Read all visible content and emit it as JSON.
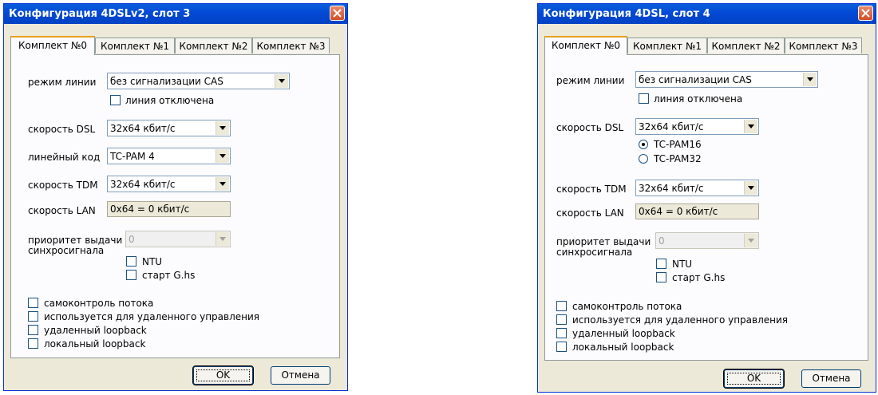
{
  "dialog1": {
    "title": "Конфигурация 4DSLv2, слот 3",
    "tabs": [
      "Комплект №0",
      "Комплект №1",
      "Комплект №2",
      "Комплект №3"
    ],
    "line_mode_label": "режим линии",
    "line_mode_value": "без сигнализации CAS",
    "line_off_label": "линия отключена",
    "dsl_speed_label": "скорость DSL",
    "dsl_speed_value": "32x64 кбит/с",
    "line_code_label": "линейный код",
    "line_code_value": "TC-PAM 4",
    "tdm_speed_label": "скорость TDM",
    "tdm_speed_value": "32x64 кбит/с",
    "lan_speed_label": "скорость LAN",
    "lan_speed_value": "0x64 = 0 кбит/с",
    "sync_priority_label_1": "приоритет выдачи",
    "sync_priority_label_2": "синхросигнала",
    "sync_priority_value": "0",
    "ntu_label": "NTU",
    "start_ghs_label": "старт G.hs",
    "self_check_label": "самоконтроль потока",
    "remote_mgmt_label": "используется для удаленного управления",
    "remote_loopback_label": "удаленный loopback",
    "local_loopback_label": "локальный loopback",
    "ok_label": "OK",
    "cancel_label": "Отмена"
  },
  "dialog2": {
    "title": "Конфигурация 4DSL, слот 4",
    "tabs": [
      "Комплект №0",
      "Комплект №1",
      "Комплект №2",
      "Комплект №3"
    ],
    "line_mode_label": "режим линии",
    "line_mode_value": "без сигнализации CAS",
    "line_off_label": "линия отключена",
    "dsl_speed_label": "скорость DSL",
    "dsl_speed_value": "32x64 кбит/с",
    "tcpam16_label": "TC-PAM16",
    "tcpam32_label": "TC-PAM32",
    "tdm_speed_label": "скорость TDM",
    "tdm_speed_value": "32x64 кбит/с",
    "lan_speed_label": "скорость LAN",
    "lan_speed_value": "0x64 = 0 кбит/с",
    "sync_priority_label_1": "приоритет выдачи",
    "sync_priority_label_2": "синхросигнала",
    "sync_priority_value": "0",
    "ntu_label": "NTU",
    "start_ghs_label": "старт G.hs",
    "self_check_label": "самоконтроль потока",
    "remote_mgmt_label": "используется для удаленного управления",
    "remote_loopback_label": "удаленный loopback",
    "local_loopback_label": "локальный loopback",
    "ok_label": "OK",
    "cancel_label": "Отмена"
  }
}
